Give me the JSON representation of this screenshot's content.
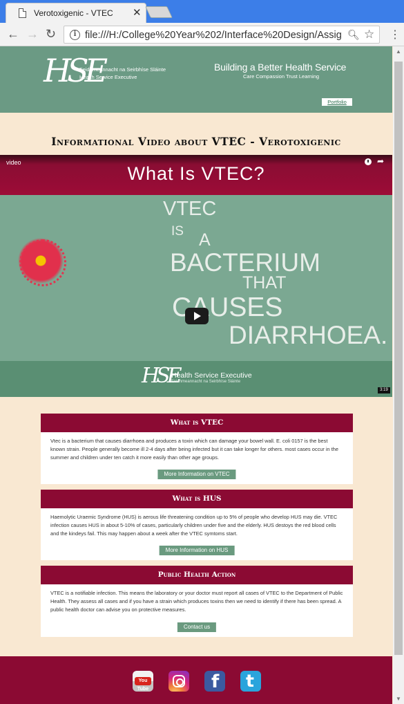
{
  "browser": {
    "tab_title": "Verotoxigenic - VTEC",
    "tab_close": "✕",
    "url": "file:///H:/College%20Year%202/Interface%20Design/Assig...",
    "controls": {
      "minimize": "—",
      "maximize": "☐",
      "close": "✕"
    }
  },
  "header": {
    "logo_mark": "HSE",
    "logo_line1": "Feidhmeannacht na Seirbhíse Sláinte",
    "logo_line2": "Health Service Executive",
    "tagline_main": "Building a Better Health Service",
    "tagline_sub": "Care  Compassion  Trust  Learning",
    "portfolio_link": "Portfolio"
  },
  "page_title": "Informational Video about VTEC - Verotoxigenic",
  "video": {
    "label": "video",
    "heading": "What Is VTEC?",
    "words": [
      "VTEC",
      "IS",
      "A",
      "BACTERIUM",
      "THAT",
      "CAUSES",
      "DIARRHOEA."
    ],
    "footer_title": "Health Service Executive",
    "footer_sub": "Feidhmeannacht na Seirbhíse Sláinte",
    "duration": "3:19"
  },
  "sections": [
    {
      "heading": "What is VTEC",
      "text": "Vtec is a bacterium that causes diarrhoea and produces a toxin which can damage your bowel wall. E. coli 0157 is the best known strain. People generally become ill 2-4 days after being infected but it can take longer for others. most cases occur in the summer and children under ten catch it more easily than other age groups.",
      "button": "More Information on VTEC"
    },
    {
      "heading": "What is HUS",
      "text": "Haemolytic Uraemic Syndrome (HUS) is aerous life threatening condition up to 5% of people who develop HUS may die. VTEC infection causes HUS in about 5-10% of cases, particularly children under five and the elderly. HUS destoys the red blood cells and the kindeys fail. This may happen about a week after the VTEC symtoms start.",
      "button": "More Information on HUS"
    },
    {
      "heading": "Public Health Action",
      "text": "VTEC is a notifiable infection. This means the laboratory or your doctor must report all cases of VTEC to the Department of Public Health. They assess all cases and if you have a strain which produces toxins then we need to identify if there has been spread. A public health doctor can advise you on protective measures.",
      "button": "Contact us"
    }
  ],
  "footer": {
    "youtube_label": "You Tube",
    "facebook_letter": "f",
    "twitter_letter": "t"
  },
  "colors": {
    "header_green": "#6b9a84",
    "maroon": "#8b0a33",
    "page_bg": "#f9e8d2",
    "button_green": "#6a9a7f"
  }
}
